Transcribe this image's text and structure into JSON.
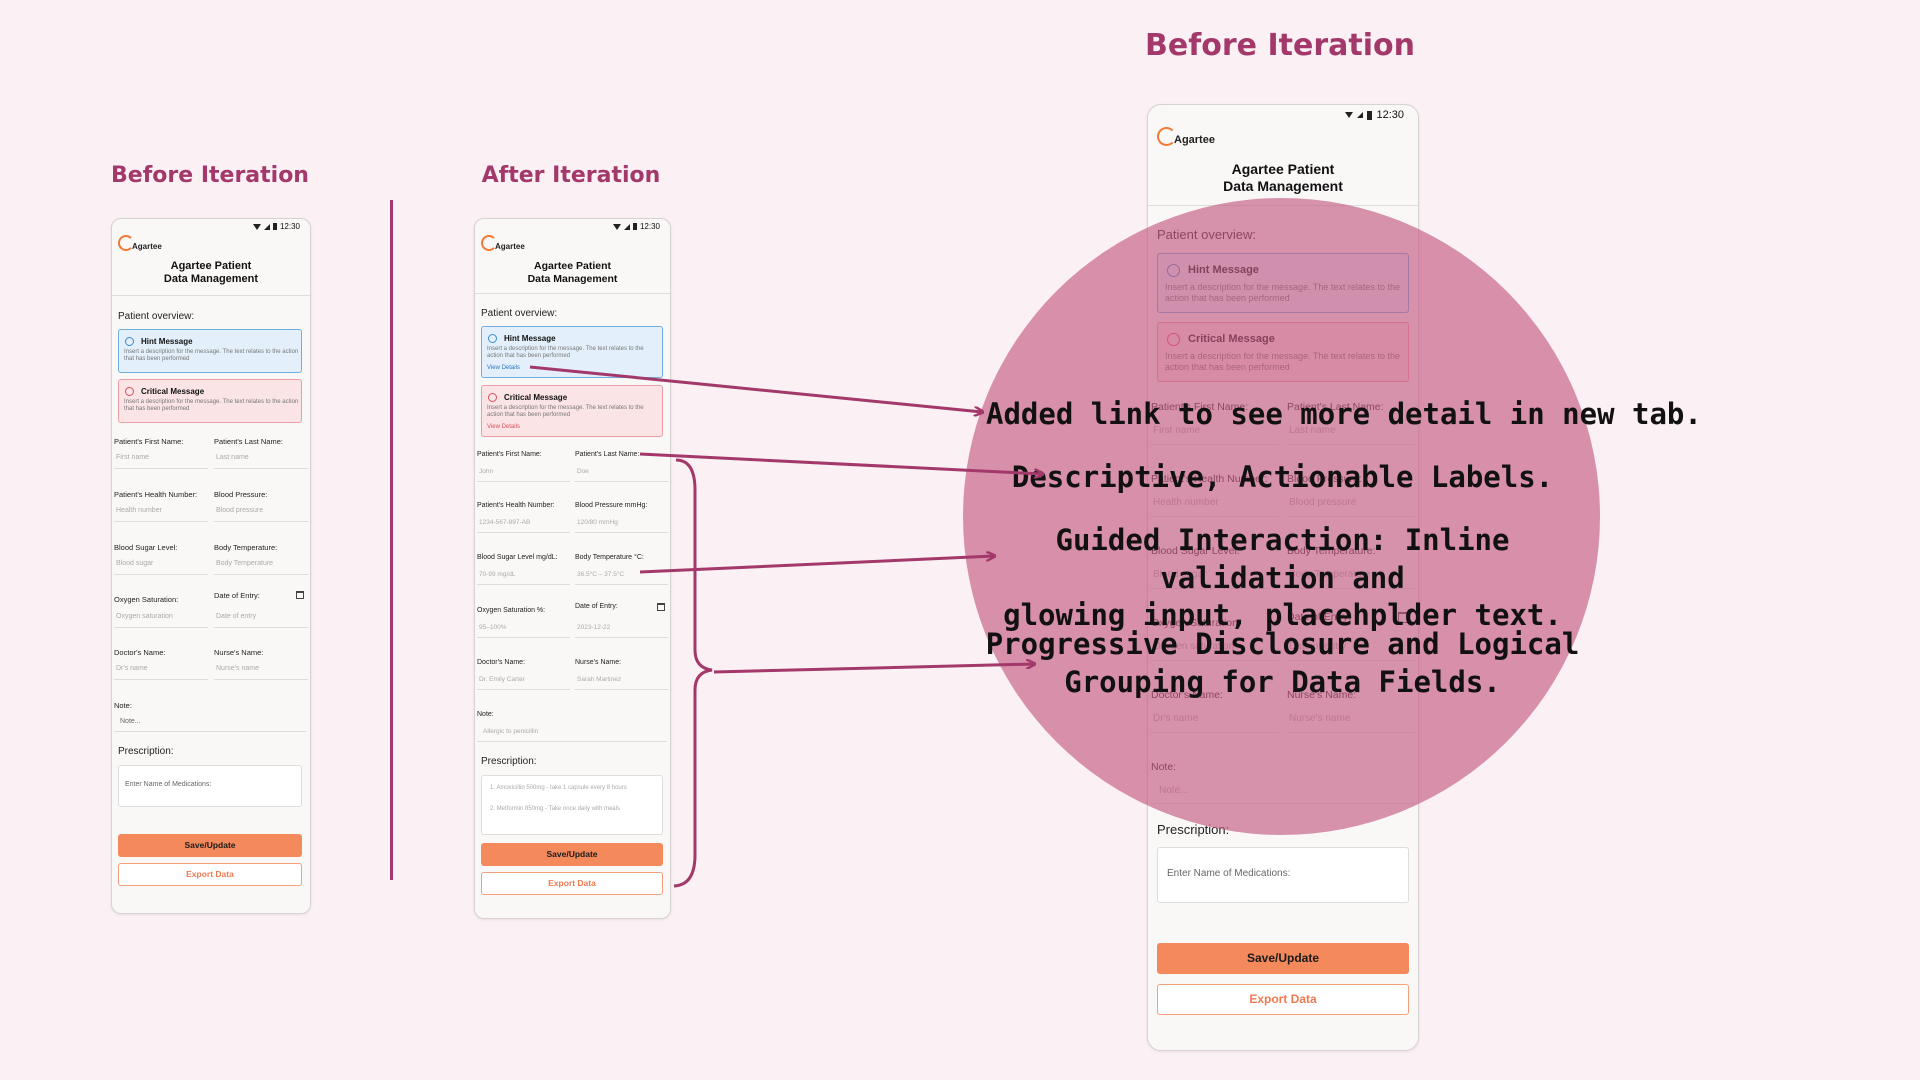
{
  "titles": {
    "left": "Before Iteration",
    "middle": "After Iteration",
    "right": "Before Iteration"
  },
  "app": {
    "time": "12:30",
    "logo": "Agartee",
    "title": "Agartee Patient\nData Management",
    "overview": "Patient overview:",
    "hint_title": "Hint Message",
    "crit_title": "Critical Message",
    "msg_desc": "Insert a description for the message. The text relates to the action that has been performed",
    "view_details": "View Details",
    "prescription": "Prescription:",
    "save": "Save/Update",
    "export": "Export Data"
  },
  "before_fields": {
    "first_name": {
      "label": "Patient's First Name:",
      "placeholder": "First name"
    },
    "last_name": {
      "label": "Patient's Last Name:",
      "placeholder": "Last name"
    },
    "health_number": {
      "label": "Patient's Health Number:",
      "placeholder": "Health number"
    },
    "blood_pressure": {
      "label": "Blood Pressure:",
      "placeholder": "Blood pressure"
    },
    "blood_sugar": {
      "label": "Blood Sugar Level:",
      "placeholder": "Blood sugar"
    },
    "body_temp": {
      "label": "Body Temperature:",
      "placeholder": "Body Temperature"
    },
    "oxygen": {
      "label": "Oxygen Saturation:",
      "placeholder": "Oxygen saturation"
    },
    "date": {
      "label": "Date of Entry:",
      "placeholder": "Date of entry"
    },
    "doctor": {
      "label": "Doctor's Name:",
      "placeholder": "Dr's name"
    },
    "nurse": {
      "label": "Nurse's Name:",
      "placeholder": "Nurse's name"
    },
    "note": {
      "label": "Note:",
      "placeholder": "Note..."
    },
    "prescription_placeholder": "Enter Name of Medications:"
  },
  "after_fields": {
    "first_name": {
      "label": "Patient's First Name:",
      "placeholder": "John"
    },
    "last_name": {
      "label": "Patient's Last Name:",
      "placeholder": "Doe"
    },
    "health_number": {
      "label": "Patient's Health Number:",
      "placeholder": "1234-567-897-AB"
    },
    "blood_pressure": {
      "label": "Blood Pressure mmHg:",
      "placeholder": "120/80 mmHg"
    },
    "blood_sugar": {
      "label": "Blood Sugar Level mg/dL:",
      "placeholder": "70-99 mg/dL"
    },
    "body_temp": {
      "label": "Body Temperature °C:",
      "placeholder": "36.5°C – 37.5°C"
    },
    "oxygen": {
      "label": "Oxygen Saturation %:",
      "placeholder": "95–100%"
    },
    "date": {
      "label": "Date of Entry:",
      "placeholder": "2023-12-22"
    },
    "doctor": {
      "label": "Doctor's Name:",
      "placeholder": "Dr. Emily Carter"
    },
    "nurse": {
      "label": "Nurse's Name:",
      "placeholder": "Sarah Martinez"
    },
    "note": {
      "label": "Note:",
      "placeholder": "Allergic to penicillin"
    },
    "rx_item1": "1. Amoxicillin 500mg - take 1 capsule every 8 hours",
    "rx_item2": "2. Metformin 850mg - Take once daily with meals"
  },
  "callouts": {
    "link": "Added link to see more detail in new tab.",
    "labels": "Descriptive, Actionable Labels.",
    "guided": "Guided Interaction: Inline validation and\nglowing input, placehplder text.",
    "progressive": "Progressive Disclosure and Logical\nGrouping for Data Fields."
  },
  "colors": {
    "accent": "#a3386a",
    "button": "#f4895b",
    "overlay": "#c45a83",
    "background": "#fbf0f4"
  },
  "icons": [
    "wifi-icon",
    "signal-icon",
    "battery-icon",
    "info-icon",
    "calendar-icon",
    "arrow-icon",
    "brace-icon"
  ]
}
